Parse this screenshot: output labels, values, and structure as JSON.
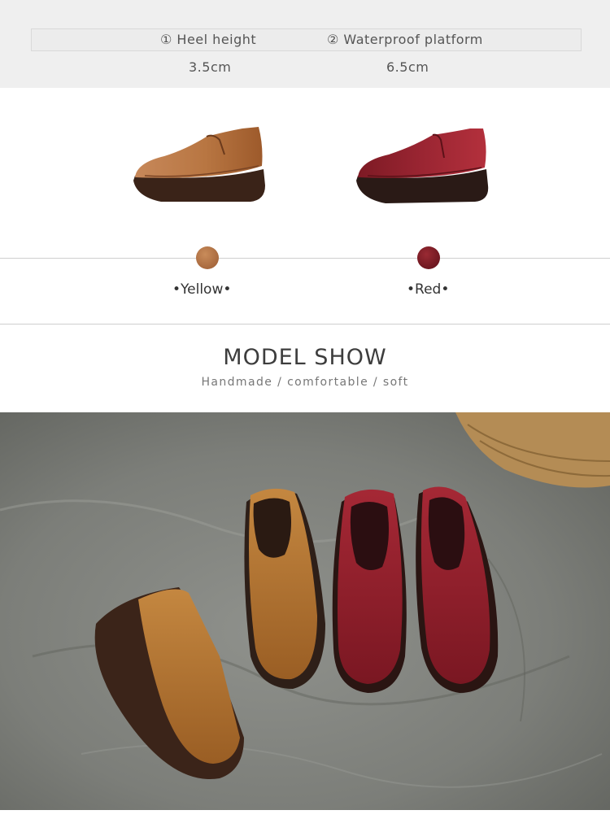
{
  "specs": {
    "label1": "① Heel height",
    "label2": "② Waterproof platform",
    "value1": "3.5cm",
    "value2": "6.5cm"
  },
  "colors": {
    "yellow": {
      "name": "•Yellow•",
      "hex": "#b0713f"
    },
    "red": {
      "name": "•Red•",
      "hex": "#7e1c25"
    }
  },
  "model_show": {
    "title": "MODEL SHOW",
    "subtitle": "Handmade / comfortable / soft"
  },
  "images": {
    "shoe_yellow": "yellow-platform-shoe-image",
    "shoe_red": "red-platform-shoe-image",
    "model_photo": "shoes-on-grey-cloth-photo"
  }
}
